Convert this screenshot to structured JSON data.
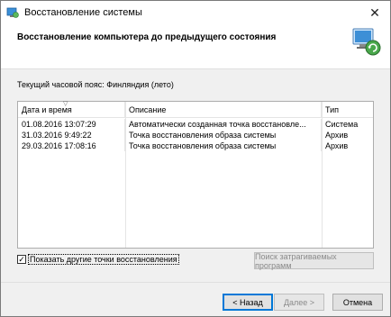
{
  "window": {
    "title": "Восстановление системы",
    "close_glyph": "✕"
  },
  "header": {
    "title": "Восстановление компьютера до предыдущего состояния",
    "icon": "system-restore-icon"
  },
  "timezone_label": "Текущий часовой пояс: Финляндия (лето)",
  "table": {
    "columns": [
      "Дата и время",
      "Описание",
      "Тип"
    ],
    "sort_glyph": "▽",
    "rows": [
      {
        "date": "01.08.2016 13:07:29",
        "description": "Автоматически созданная точка восстановле...",
        "type": "Система"
      },
      {
        "date": "31.03.2016 9:49:22",
        "description": "Точка восстановления образа системы",
        "type": "Архив"
      },
      {
        "date": "29.03.2016 17:08:16",
        "description": "Точка восстановления образа системы",
        "type": "Архив"
      }
    ]
  },
  "show_more": {
    "label": "Показать другие точки восстановления",
    "checked": true,
    "check_glyph": "✓"
  },
  "buttons": {
    "search": "Поиск затрагиваемых программ",
    "back": "< Назад",
    "next": "Далее >",
    "cancel": "Отмена"
  },
  "colors": {
    "accent": "#0078d7",
    "window_bg": "#f0f0f0",
    "disabled_text": "#8a8a8a"
  }
}
